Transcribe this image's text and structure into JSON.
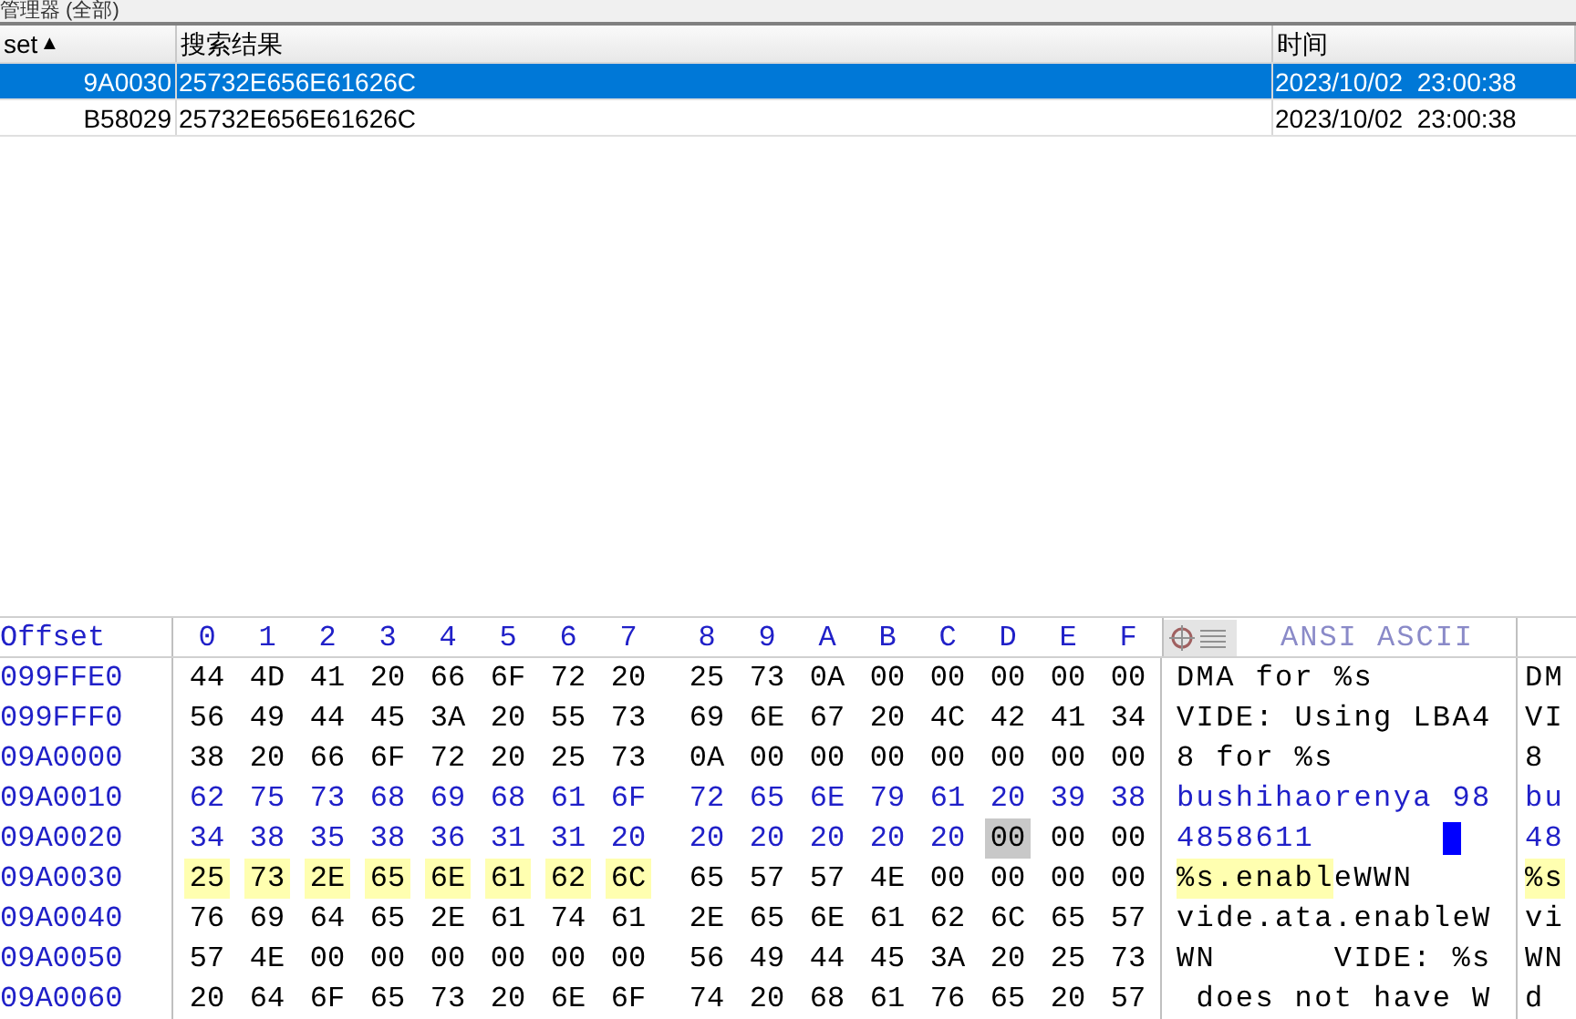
{
  "panel": {
    "title": "管理器 (全部)"
  },
  "results_table": {
    "columns": [
      {
        "label": "set",
        "sort_indicator": "▲"
      },
      {
        "label": "搜索结果"
      },
      {
        "label": "时间"
      }
    ],
    "rows": [
      {
        "selected": true,
        "offset": "9A0030",
        "result": "25732E656E61626C",
        "time": "2023/10/02  23:00:38"
      },
      {
        "selected": false,
        "offset": "B58029",
        "result": "25732E656E61626C",
        "time": "2023/10/02  23:00:38"
      }
    ]
  },
  "hex_editor": {
    "offset_header": "Offset",
    "column_headers": [
      "0",
      "1",
      "2",
      "3",
      "4",
      "5",
      "6",
      "7",
      "8",
      "9",
      "A",
      "B",
      "C",
      "D",
      "E",
      "F"
    ],
    "text_header": "ANSI ASCII",
    "rows": [
      {
        "offset": "099FFE0",
        "segments": [
          {
            "kind": "plain",
            "bytes": [
              "44",
              "4D",
              "41",
              "20",
              "66",
              "6F",
              "72",
              "20",
              "25",
              "73",
              "0A",
              "00",
              "00",
              "00",
              "00",
              "00"
            ]
          }
        ],
        "ascii": [
          {
            "kind": "plain",
            "text": "DMA for %s"
          }
        ],
        "ascii_cursor": false,
        "ascii_clipped": [
          {
            "kind": "plain",
            "text": "DM"
          }
        ]
      },
      {
        "offset": "099FFF0",
        "segments": [
          {
            "kind": "plain",
            "bytes": [
              "56",
              "49",
              "44",
              "45",
              "3A",
              "20",
              "55",
              "73",
              "69",
              "6E",
              "67",
              "20",
              "4C",
              "42",
              "41",
              "34"
            ]
          }
        ],
        "ascii": [
          {
            "kind": "plain",
            "text": "VIDE: Using LBA4"
          }
        ],
        "ascii_cursor": false,
        "ascii_clipped": [
          {
            "kind": "plain",
            "text": "VI"
          }
        ]
      },
      {
        "offset": "09A0000",
        "segments": [
          {
            "kind": "plain",
            "bytes": [
              "38",
              "20",
              "66",
              "6F",
              "72",
              "20",
              "25",
              "73",
              "0A",
              "00",
              "00",
              "00",
              "00",
              "00",
              "00",
              "00"
            ]
          }
        ],
        "ascii": [
          {
            "kind": "plain",
            "text": "8 for %s"
          }
        ],
        "ascii_cursor": false,
        "ascii_clipped": [
          {
            "kind": "plain",
            "text": "8"
          }
        ]
      },
      {
        "offset": "09A0010",
        "segments": [
          {
            "kind": "edited",
            "bytes": [
              "62",
              "75",
              "73",
              "68",
              "69",
              "68",
              "61",
              "6F",
              "72",
              "65",
              "6E",
              "79",
              "61",
              "20",
              "39",
              "38"
            ]
          }
        ],
        "ascii": [
          {
            "kind": "edited",
            "text": "bushihaorenya 98"
          }
        ],
        "ascii_cursor": false,
        "ascii_clipped": [
          {
            "kind": "edited",
            "text": "bu"
          }
        ]
      },
      {
        "offset": "09A0020",
        "segments": [
          {
            "kind": "edited",
            "bytes": [
              "34",
              "38",
              "35",
              "38",
              "36",
              "31",
              "31",
              "20",
              "20",
              "20",
              "20",
              "20",
              "20"
            ]
          },
          {
            "kind": "cursor",
            "bytes": [
              "00"
            ]
          },
          {
            "kind": "plain",
            "bytes": [
              "00",
              "00"
            ]
          }
        ],
        "ascii": [
          {
            "kind": "edited",
            "text": "4858611"
          }
        ],
        "ascii_cursor": true,
        "ascii_clipped": [
          {
            "kind": "edited",
            "text": "48"
          }
        ]
      },
      {
        "offset": "09A0030",
        "segments": [
          {
            "kind": "highlight",
            "bytes": [
              "25",
              "73",
              "2E",
              "65",
              "6E",
              "61",
              "62",
              "6C"
            ]
          },
          {
            "kind": "plain",
            "bytes": [
              "65",
              "57",
              "57",
              "4E",
              "00",
              "00",
              "00",
              "00"
            ]
          }
        ],
        "ascii": [
          {
            "kind": "highlight",
            "text": "%s.enabl"
          },
          {
            "kind": "plain",
            "text": "eWWN"
          }
        ],
        "ascii_cursor": false,
        "ascii_clipped": [
          {
            "kind": "highlight",
            "text": "%s"
          }
        ]
      },
      {
        "offset": "09A0040",
        "segments": [
          {
            "kind": "plain",
            "bytes": [
              "76",
              "69",
              "64",
              "65",
              "2E",
              "61",
              "74",
              "61",
              "2E",
              "65",
              "6E",
              "61",
              "62",
              "6C",
              "65",
              "57"
            ]
          }
        ],
        "ascii": [
          {
            "kind": "plain",
            "text": "vide.ata.enableW"
          }
        ],
        "ascii_cursor": false,
        "ascii_clipped": [
          {
            "kind": "plain",
            "text": "vi"
          }
        ]
      },
      {
        "offset": "09A0050",
        "segments": [
          {
            "kind": "plain",
            "bytes": [
              "57",
              "4E",
              "00",
              "00",
              "00",
              "00",
              "00",
              "00",
              "56",
              "49",
              "44",
              "45",
              "3A",
              "20",
              "25",
              "73"
            ]
          }
        ],
        "ascii": [
          {
            "kind": "plain",
            "text": "WN      VIDE: %s"
          }
        ],
        "ascii_cursor": false,
        "ascii_clipped": [
          {
            "kind": "plain",
            "text": "WN"
          }
        ]
      },
      {
        "offset": "09A0060",
        "segments": [
          {
            "kind": "plain",
            "bytes": [
              "20",
              "64",
              "6F",
              "65",
              "73",
              "20",
              "6E",
              "6F",
              "74",
              "20",
              "68",
              "61",
              "76",
              "65",
              "20",
              "57"
            ]
          }
        ],
        "ascii": [
          {
            "kind": "plain",
            "text": " does not have W"
          }
        ],
        "ascii_cursor": false,
        "ascii_clipped": [
          {
            "kind": "plain",
            "text": "d"
          }
        ]
      }
    ]
  }
}
